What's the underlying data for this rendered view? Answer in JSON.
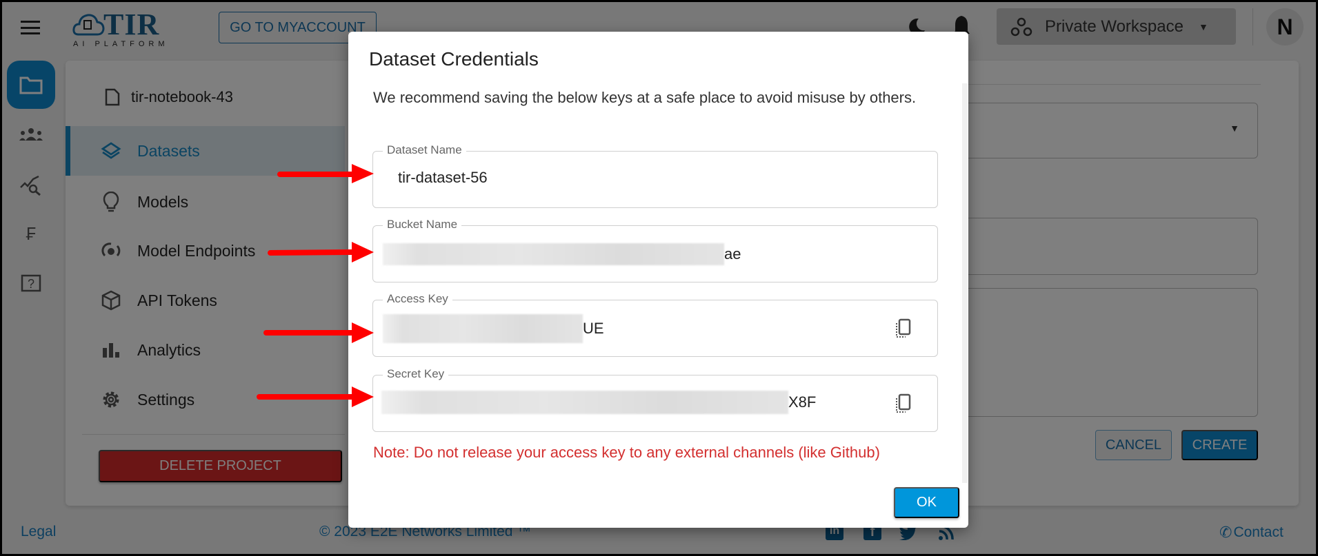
{
  "header": {
    "logo_text": "TIR",
    "logo_subtext": "AI PLATFORM",
    "myaccount_label": "GO TO MYACCOUNT",
    "workspace_label": "Private Workspace",
    "avatar_initial": "N"
  },
  "sidebar": {
    "notebook": "tir-notebook-43",
    "items": [
      {
        "label": "Datasets",
        "active": true
      },
      {
        "label": "Models"
      },
      {
        "label": "Model Endpoints"
      },
      {
        "label": "API Tokens"
      },
      {
        "label": "Analytics"
      },
      {
        "label": "Settings"
      }
    ],
    "delete_label": "DELETE PROJECT"
  },
  "form": {
    "cancel_label": "CANCEL",
    "create_label": "CREATE"
  },
  "footer": {
    "legal": "Legal",
    "copyright": "© 2023 E2E Networks Limited ™",
    "contact": "Contact"
  },
  "dialog": {
    "title": "Dataset Credentials",
    "message": "We recommend saving the below keys at a safe place to avoid misuse by others.",
    "fields": [
      {
        "label": "Dataset Name",
        "value": "tir-dataset-56"
      },
      {
        "label": "Bucket Name",
        "value_visible_suffix": "ae"
      },
      {
        "label": "Access Key",
        "value_visible_suffix": "UE"
      },
      {
        "label": "Secret Key",
        "value_visible_suffix": "X8F"
      }
    ],
    "note": "Note: Do not release your access key to any external channels (like Github)",
    "ok_label": "OK"
  },
  "colors": {
    "accent": "#0f8ad0",
    "ok": "#0096db",
    "danger": "#d62b2b",
    "note": "#d32f2f",
    "annotation_arrow": "#ff0000"
  }
}
